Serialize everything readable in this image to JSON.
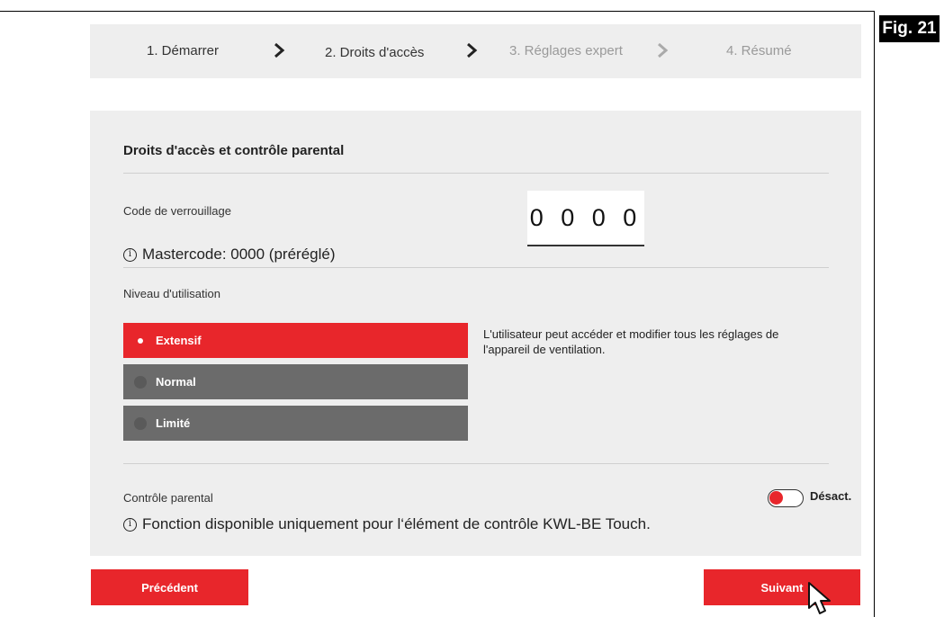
{
  "figure_label": "Fig. 21",
  "stepper": {
    "steps": [
      {
        "label": "1. Démarrer",
        "state": "done"
      },
      {
        "label": "2. Droits d'accès",
        "state": "current"
      },
      {
        "label": "3. Réglages expert",
        "state": "disabled"
      },
      {
        "label": "4. Résumé",
        "state": "disabled"
      }
    ]
  },
  "section": {
    "title": "Droits d'accès et contrôle parental",
    "lock_code": {
      "label": "Code de verrouillage",
      "value": "0000",
      "note": "Mastercode: 0000 (préréglé)"
    },
    "usage_level": {
      "label": "Niveau d'utilisation",
      "options": [
        {
          "label": "Extensif",
          "selected": true
        },
        {
          "label": "Normal",
          "selected": false
        },
        {
          "label": "Limité",
          "selected": false
        }
      ],
      "description": "L'utilisateur peut accéder et modifier tous les réglages de l'appareil de ventilation."
    },
    "parental_control": {
      "label": "Contrôle parental",
      "toggle_state": "Désact.",
      "note": "Fonction disponible uniquement pour l‘élément de contrôle KWL-BE Touch."
    }
  },
  "buttons": {
    "previous": "Précédent",
    "next": "Suivant"
  },
  "colors": {
    "accent": "#e8262b",
    "inactive_option": "#6b6b6b",
    "panel_bg": "#eeeeee"
  }
}
